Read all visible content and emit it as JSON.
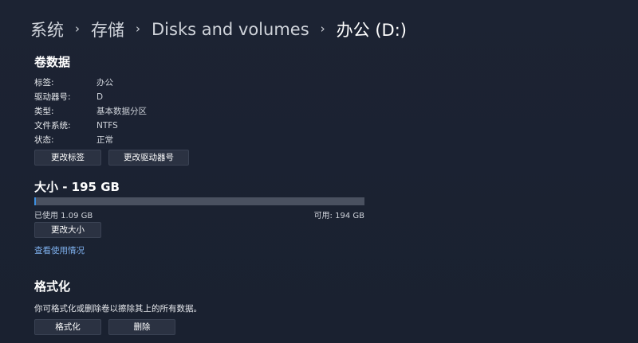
{
  "breadcrumb": {
    "items": [
      "系统",
      "存储",
      "Disks and volumes",
      "办公 (D:)"
    ],
    "separator": "›"
  },
  "volume_data": {
    "title": "卷数据",
    "properties": [
      {
        "label": "标签:",
        "value": "办公"
      },
      {
        "label": "驱动器号:",
        "value": "D"
      },
      {
        "label": "类型:",
        "value": "基本数据分区"
      },
      {
        "label": "文件系统:",
        "value": "NTFS"
      },
      {
        "label": "状态:",
        "value": "正常"
      }
    ],
    "change_label_button": "更改标签",
    "change_drive_letter_button": "更改驱动器号"
  },
  "size": {
    "title": "大小 - 195 GB",
    "used_text": "已使用 1.09 GB",
    "available_text": "可用: 194 GB",
    "used_fraction": 0.0056,
    "resize_button": "更改大小",
    "view_usage_link": "查看使用情况"
  },
  "format": {
    "title": "格式化",
    "description": "你可格式化或删除卷以擦除其上的所有数据。",
    "format_button": "格式化",
    "delete_button": "删除"
  },
  "colors": {
    "background": "#1b2231",
    "accent": "#3d8fe0",
    "link": "#7fb2f0"
  }
}
